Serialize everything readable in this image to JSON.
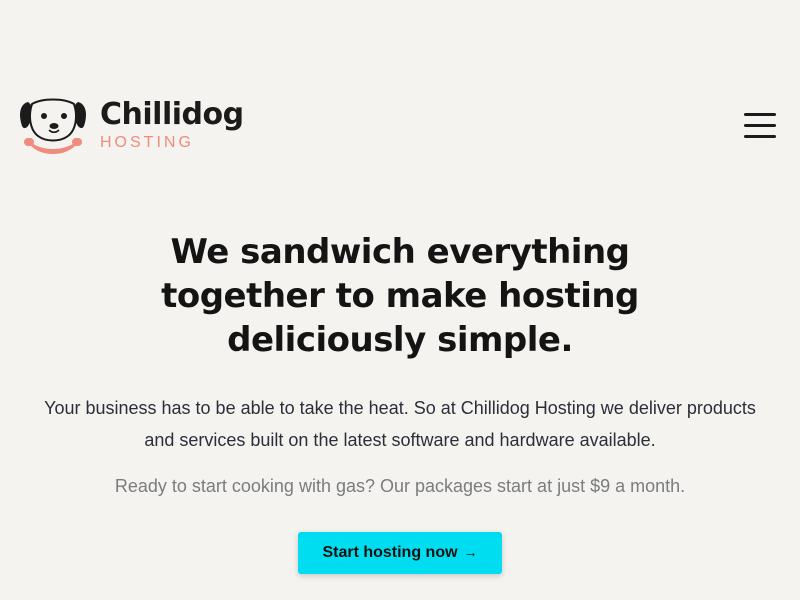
{
  "brand": {
    "name": "Chillidog",
    "sub": "HOSTING",
    "accent": "#ef8c7d"
  },
  "nav": {
    "menu_icon": "hamburger-menu-icon"
  },
  "hero": {
    "headline": "We sandwich everything together to make hosting deliciously simple.",
    "lead": "Your business has to be able to take the heat. So at Chillidog Hosting we deliver products and services built on the latest software and hardware available.",
    "note": "Ready to start cooking with gas? Our packages start at just $9 a month.",
    "cta_label": "Start hosting now",
    "cta_icon": "arrow-right-icon",
    "cta_color": "#00ddf0"
  },
  "colors": {
    "background": "#f5f3ef",
    "text": "#1b1b1b",
    "muted": "#7a7c80"
  }
}
